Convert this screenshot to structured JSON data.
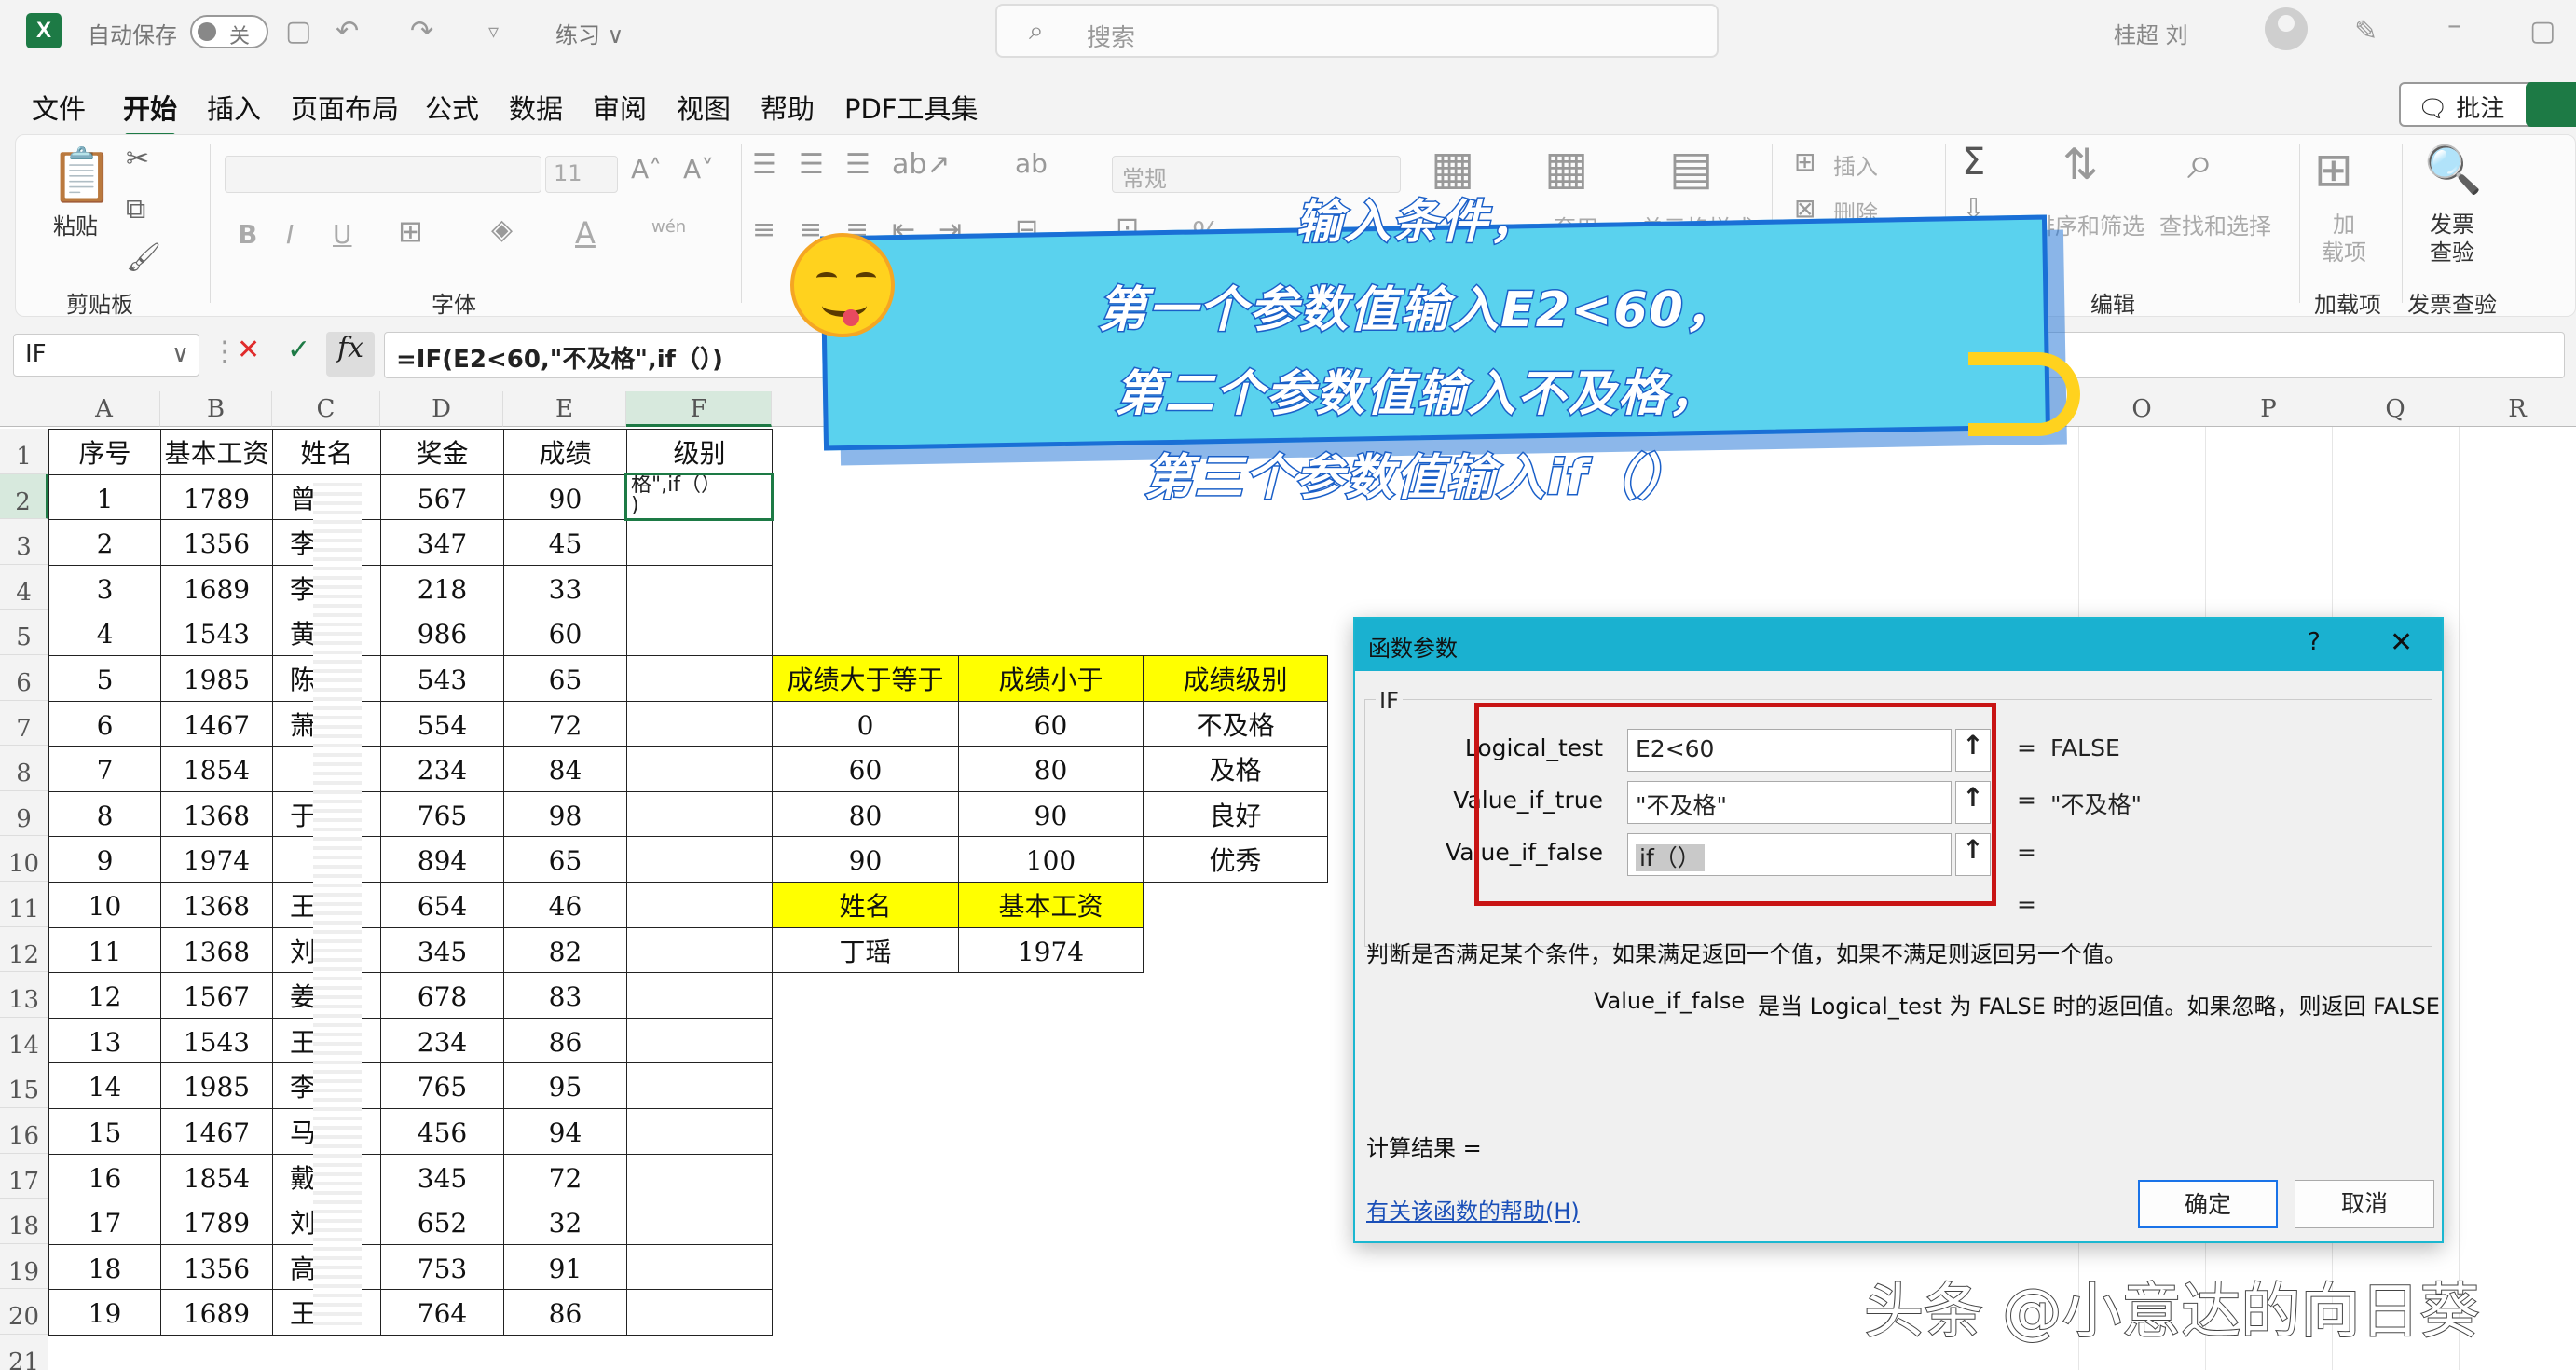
{
  "titlebar": {
    "logo": "X",
    "autosave_label": "自动保存",
    "autosave_state": "关",
    "document_name": "练习",
    "search_placeholder": "搜索",
    "user_name": "桂超 刘"
  },
  "menu": {
    "items": [
      "文件",
      "开始",
      "插入",
      "页面布局",
      "公式",
      "数据",
      "审阅",
      "视图",
      "帮助",
      "PDF工具集"
    ],
    "active": "开始",
    "comments_button": "批注"
  },
  "ribbon": {
    "clipboard": {
      "paste": "粘贴",
      "group": "剪贴板"
    },
    "font": {
      "group": "字体",
      "size": "11",
      "bold": "B",
      "italic": "I",
      "underline": "U",
      "font_color": "A",
      "phonetic": "wén"
    },
    "number": {
      "format": "常规",
      "percent": "%"
    },
    "styles": {
      "cond_fmt": "套用",
      "cell_styles": "单元格样式"
    },
    "cells": {
      "insert": "插入",
      "delete": "删除"
    },
    "editing": {
      "sort_filter": "排序和筛选",
      "find_select": "查找和选择",
      "group": "编辑"
    },
    "addins": {
      "label_line1": "加",
      "label_line2": "载项",
      "group": "加载项"
    },
    "invoice": {
      "label_line1": "发票",
      "label_line2": "查验",
      "group": "发票查验"
    }
  },
  "formula_bar": {
    "name_box": "IF",
    "formula": "=IF(E2<60,\"不及格\",if（）)"
  },
  "sheet": {
    "columns": [
      "A",
      "B",
      "C",
      "D",
      "E",
      "F",
      "O",
      "P",
      "Q",
      "R"
    ],
    "rows": [
      "1",
      "2",
      "3",
      "4",
      "5",
      "6",
      "7",
      "8",
      "9",
      "10",
      "11",
      "12",
      "13",
      "14",
      "15",
      "16",
      "17",
      "18",
      "19",
      "20",
      "21"
    ],
    "headers": [
      "序号",
      "基本工资",
      "姓名",
      "奖金",
      "成绩",
      "级别"
    ],
    "data": [
      {
        "no": "1",
        "salary": "1789",
        "name": "曾",
        "bonus": "567",
        "score": "90"
      },
      {
        "no": "2",
        "salary": "1356",
        "name": "李",
        "bonus": "347",
        "score": "45"
      },
      {
        "no": "3",
        "salary": "1689",
        "name": "李",
        "bonus": "218",
        "score": "33"
      },
      {
        "no": "4",
        "salary": "1543",
        "name": "黄",
        "bonus": "986",
        "score": "60"
      },
      {
        "no": "5",
        "salary": "1985",
        "name": "陈",
        "bonus": "543",
        "score": "65"
      },
      {
        "no": "6",
        "salary": "1467",
        "name": "萧",
        "bonus": "554",
        "score": "72"
      },
      {
        "no": "7",
        "salary": "1854",
        "name": "",
        "bonus": "234",
        "score": "84"
      },
      {
        "no": "8",
        "salary": "1368",
        "name": "于",
        "bonus": "765",
        "score": "98"
      },
      {
        "no": "9",
        "salary": "1974",
        "name": "",
        "bonus": "894",
        "score": "65"
      },
      {
        "no": "10",
        "salary": "1368",
        "name": "王",
        "bonus": "654",
        "score": "46"
      },
      {
        "no": "11",
        "salary": "1368",
        "name": "刘",
        "bonus": "345",
        "score": "82"
      },
      {
        "no": "12",
        "salary": "1567",
        "name": "姜",
        "bonus": "678",
        "score": "83"
      },
      {
        "no": "13",
        "salary": "1543",
        "name": "王",
        "bonus": "234",
        "score": "86"
      },
      {
        "no": "14",
        "salary": "1985",
        "name": "李",
        "bonus": "765",
        "score": "95"
      },
      {
        "no": "15",
        "salary": "1467",
        "name": "马",
        "bonus": "456",
        "score": "94"
      },
      {
        "no": "16",
        "salary": "1854",
        "name": "戴",
        "bonus": "345",
        "score": "72"
      },
      {
        "no": "17",
        "salary": "1789",
        "name": "刘",
        "bonus": "652",
        "score": "32"
      },
      {
        "no": "18",
        "salary": "1356",
        "name": "高",
        "bonus": "753",
        "score": "91"
      },
      {
        "no": "19",
        "salary": "1689",
        "name": "王",
        "bonus": "764",
        "score": "86"
      }
    ],
    "active_cell_text": "格\",if（）\n)",
    "grade_table": {
      "headers": [
        "成绩大于等于",
        "成绩小于",
        "成绩级别"
      ],
      "rows": [
        [
          "0",
          "60",
          "不及格"
        ],
        [
          "60",
          "80",
          "及格"
        ],
        [
          "80",
          "90",
          "良好"
        ],
        [
          "90",
          "100",
          "优秀"
        ]
      ]
    },
    "lookup_table": {
      "headers": [
        "姓名",
        "基本工资"
      ],
      "row": [
        "丁瑶",
        "1974"
      ]
    }
  },
  "banner": {
    "lines": [
      "输入条件，",
      "第一个参数值输入E2<60，",
      "第二个参数值输入不及格，",
      "第三个参数值输入if（）"
    ]
  },
  "dialog": {
    "title": "函数参数",
    "help_mark": "?",
    "close": "✕",
    "function_name": "IF",
    "args": [
      {
        "label": "Logical_test",
        "value": "E2<60",
        "result": "FALSE"
      },
      {
        "label": "Value_if_true",
        "value": "\"不及格\"",
        "result": "\"不及格\""
      },
      {
        "label": "Value_if_false",
        "value": "if（）",
        "result": ""
      }
    ],
    "eq": "=",
    "description": "判断是否满足某个条件，如果满足返回一个值，如果不满足则返回另一个值。",
    "arg_help_name": "Value_if_false",
    "arg_help_text": "是当 Logical_test 为 FALSE 时的返回值。如果忽略，则返回 FALSE",
    "calc_result_label": "计算结果 =",
    "help_link": "有关该函数的帮助(H)",
    "ok": "确定",
    "cancel": "取消"
  },
  "watermark": "头条 @小意达的向日葵"
}
